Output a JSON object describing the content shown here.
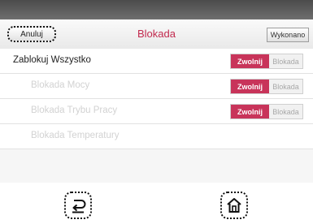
{
  "header": {
    "cancel_label": "Anuluj",
    "title": "Blokada",
    "done_label": "Wykonano"
  },
  "rows": [
    {
      "label": "Zablokuj Wszystko",
      "toggle": {
        "on_label": "Zwolnij",
        "off_label": "Blokada"
      }
    },
    {
      "label": "Blokada Mocy",
      "toggle": {
        "on_label": "Zwolnij",
        "off_label": "Blokada"
      }
    },
    {
      "label": "Blokada Trybu Pracy",
      "toggle": {
        "on_label": "Zwolnij",
        "off_label": "Blokada"
      }
    },
    {
      "label": "Blokada Temperatury"
    }
  ],
  "nav": {
    "back_icon": "back-arrow-icon",
    "home_icon": "home-icon"
  },
  "colors": {
    "accent": "#c8345a",
    "title": "#c22a4e",
    "disabled_text": "#d2d2d2"
  }
}
